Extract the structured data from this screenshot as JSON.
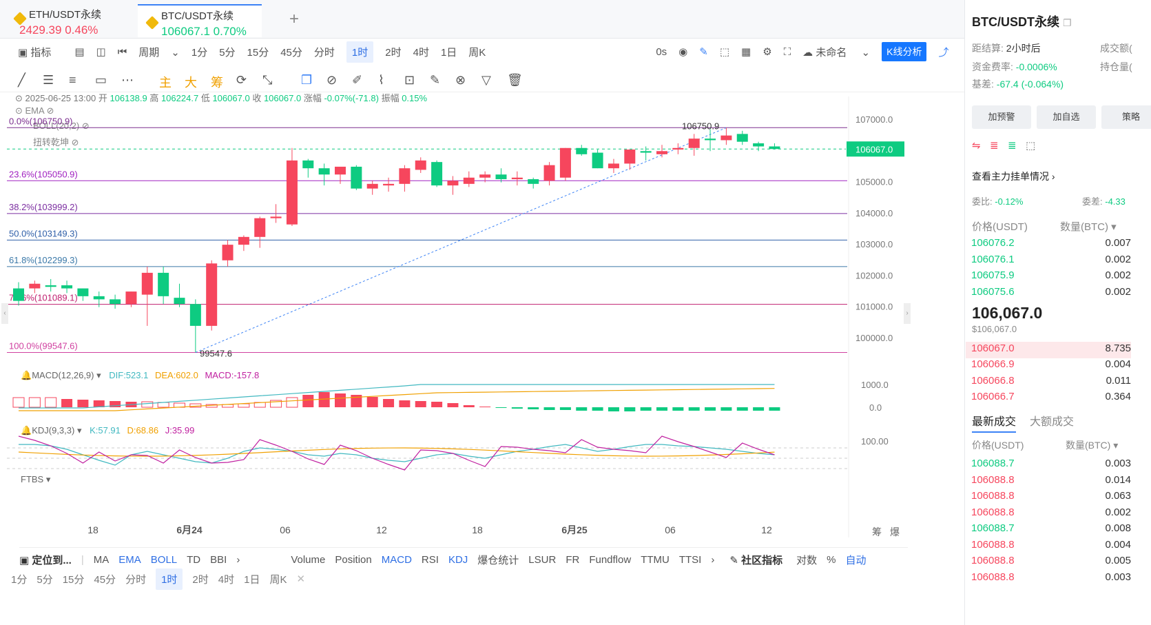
{
  "tabs": [
    {
      "name": "ETH/USDT永续",
      "price": "2429.39",
      "change": "0.46%",
      "color": "#f6465d"
    },
    {
      "name": "BTC/USDT永续",
      "price": "106067.1",
      "change": "0.70%",
      "color": "#0ecb81"
    }
  ],
  "toolbar": {
    "indicator": "指标",
    "period": "周期",
    "intervals": [
      "1分",
      "5分",
      "15分",
      "45分",
      "分时",
      "1时",
      "2时",
      "4时",
      "1日",
      "周K"
    ],
    "selected_interval": "1时",
    "countdown": "0s",
    "layout_name": "未命名",
    "analysis": "K线分析"
  },
  "draw_tools": {
    "zhu": "主",
    "da": "大",
    "chou": "筹"
  },
  "ohlc": {
    "time": "2025-06-25 13:00",
    "open_label": "开",
    "open": "106138.9",
    "high_label": "高",
    "high": "106224.7",
    "low_label": "低",
    "low": "106067.0",
    "close_label": "收",
    "close": "106067.0",
    "change_label": "涨幅",
    "change": "-0.07%(-71.8)",
    "amp_label": "振幅",
    "amp": "0.15%"
  },
  "overlays": {
    "ema": "EMA",
    "boll": "BOLL(20,2)",
    "twist": "扭转乾坤"
  },
  "fib_levels": [
    {
      "label": "0.0%(106750.9)",
      "price": 106750.9,
      "color": "#7b2d8e"
    },
    {
      "label": "23.6%(105050.9)",
      "price": 105050.9,
      "color": "#a020c0"
    },
    {
      "label": "38.2%(103999.2)",
      "price": 103999.2,
      "color": "#7b2da0"
    },
    {
      "label": "50.0%(103149.3)",
      "price": 103149.3,
      "color": "#2f5fa8"
    },
    {
      "label": "61.8%(102299.3)",
      "price": 102299.3,
      "color": "#3a78a8"
    },
    {
      "label": "78.6%(101089.1)",
      "price": 101089.1,
      "color": "#c02070"
    },
    {
      "label": "100.0%(99547.6)",
      "price": 99547.6,
      "color": "#d040a0"
    }
  ],
  "price_axis": [
    "107000.0",
    "106000.0",
    "105000.0",
    "104000.0",
    "103000.0",
    "102000.0",
    "101000.0",
    "100000.0"
  ],
  "last_price_tag": "106067.0",
  "high_marker": "106750.9",
  "low_marker": "99547.6",
  "chart_data": {
    "type": "candlestick",
    "ylim": [
      99300,
      107300
    ],
    "candles": [
      [
        101600,
        101800,
        101050,
        101200
      ],
      [
        101600,
        101850,
        101450,
        101750
      ],
      [
        101700,
        101900,
        101500,
        101650
      ],
      [
        101700,
        101850,
        101450,
        101600
      ],
      [
        101600,
        101600,
        101200,
        101350
      ],
      [
        101350,
        101500,
        101000,
        101250
      ],
      [
        101250,
        101400,
        100950,
        101100
      ],
      [
        101100,
        101500,
        101000,
        101500
      ],
      [
        101400,
        102300,
        100400,
        102100
      ],
      [
        102100,
        102300,
        101100,
        101350
      ],
      [
        101300,
        101750,
        101000,
        101100
      ],
      [
        101100,
        101250,
        99550,
        100400
      ],
      [
        100400,
        102500,
        100250,
        102400
      ],
      [
        102500,
        103150,
        102300,
        103000
      ],
      [
        103000,
        103300,
        102800,
        103250
      ],
      [
        103250,
        103900,
        102900,
        103850
      ],
      [
        103850,
        104300,
        103700,
        103900
      ],
      [
        103650,
        106100,
        103600,
        105700
      ],
      [
        105700,
        105750,
        105150,
        105450
      ],
      [
        105450,
        105600,
        104900,
        105250
      ],
      [
        105250,
        105450,
        104950,
        105500
      ],
      [
        105500,
        105550,
        104750,
        104800
      ],
      [
        104800,
        105050,
        104600,
        104950
      ],
      [
        104900,
        105150,
        104700,
        104950
      ],
      [
        104950,
        105550,
        104700,
        105450
      ],
      [
        105400,
        105800,
        105300,
        105700
      ],
      [
        105650,
        105700,
        104850,
        104900
      ],
      [
        104900,
        105200,
        104600,
        105050
      ],
      [
        104950,
        105350,
        104850,
        105150
      ],
      [
        105150,
        105350,
        105000,
        105250
      ],
      [
        105250,
        105450,
        105000,
        105100
      ],
      [
        105100,
        105350,
        104900,
        105150
      ],
      [
        105100,
        105150,
        104800,
        104950
      ],
      [
        105050,
        105650,
        104900,
        105550
      ],
      [
        105150,
        106100,
        105050,
        106100
      ],
      [
        106100,
        106200,
        105850,
        105900
      ],
      [
        105950,
        106050,
        105450,
        105450
      ],
      [
        105450,
        105750,
        105300,
        105600
      ],
      [
        105600,
        106000,
        105400,
        106050
      ],
      [
        106000,
        106150,
        105700,
        105950
      ],
      [
        105900,
        106200,
        105800,
        106000
      ],
      [
        106050,
        106250,
        105900,
        106100
      ],
      [
        106100,
        106550,
        105850,
        106400
      ],
      [
        106400,
        106700,
        106000,
        106350
      ],
      [
        106350,
        106750,
        106200,
        106500
      ],
      [
        106550,
        106650,
        106200,
        106300
      ],
      [
        106250,
        106300,
        106000,
        106150
      ],
      [
        106150,
        106250,
        106050,
        106067
      ]
    ]
  },
  "macd": {
    "label": "MACD(12,26,9)",
    "dif": "DIF:523.1",
    "dea": "DEA:602.0",
    "macd": "MACD:-157.8",
    "axis": [
      "1000.0",
      "0.0"
    ]
  },
  "kdj": {
    "label": "KDJ(9,3,3)",
    "k": "K:57.91",
    "d": "D:68.86",
    "j": "J:35.99",
    "axis": "100.00"
  },
  "ftbs": "FTBS",
  "x_labels": [
    "18",
    "6月24",
    "06",
    "12",
    "18",
    "6月25",
    "06",
    "12"
  ],
  "bottom_right": [
    "筹",
    "爆"
  ],
  "indicator_bar": {
    "locate": "定位到...",
    "main": [
      "MA",
      "EMA",
      "BOLL",
      "TD",
      "BBI"
    ],
    "sub": [
      "Volume",
      "Position",
      "MACD",
      "RSI",
      "KDJ",
      "爆仓统计",
      "LSUR",
      "FR",
      "Fundflow",
      "TTMU",
      "TTSI"
    ],
    "community": "社区指标",
    "log": "对数",
    "pct": "%",
    "auto": "自动"
  },
  "interval_bar": [
    "1分",
    "5分",
    "15分",
    "45分",
    "分时",
    "1时",
    "2时",
    "4时",
    "1日",
    "周K"
  ],
  "panel": {
    "title": "BTC/USDT永续",
    "settle_label": "距结算:",
    "settle": "2小时后",
    "fee_label": "资金费率:",
    "fee": "-0.0006%",
    "basis_label": "基差:",
    "basis": "-67.4 (-0.064%)",
    "vol_label": "成交额(",
    "oi_label": "持仓量(",
    "buttons": [
      "加预警",
      "加自选",
      "策略"
    ],
    "depth_link": "查看主力挂单情况",
    "ratio_label": "委比:",
    "ratio": "-0.12%",
    "diff_label": "委差:",
    "diff": "-4.33",
    "price_head": "价格(USDT)",
    "qty_head": "数量(BTC)",
    "asks": [
      [
        "106076.2",
        "0.007"
      ],
      [
        "106076.1",
        "0.002"
      ],
      [
        "106075.9",
        "0.002"
      ],
      [
        "106075.6",
        "0.002"
      ]
    ],
    "last": "106,067.0",
    "last_usd": "$106,067.0",
    "bids": [
      [
        "106067.0",
        "8.735"
      ],
      [
        "106066.9",
        "0.004"
      ],
      [
        "106066.8",
        "0.011"
      ],
      [
        "106066.7",
        "0.364"
      ]
    ],
    "trade_tabs": [
      "最新成交",
      "大额成交"
    ],
    "trades": [
      [
        "106088.7",
        "0.003",
        "g"
      ],
      [
        "106088.8",
        "0.014",
        "r"
      ],
      [
        "106088.8",
        "0.063",
        "r"
      ],
      [
        "106088.8",
        "0.002",
        "r"
      ],
      [
        "106088.7",
        "0.008",
        "g"
      ],
      [
        "106088.8",
        "0.004",
        "r"
      ],
      [
        "106088.8",
        "0.005",
        "r"
      ],
      [
        "106088.8",
        "0.003",
        "r"
      ]
    ]
  }
}
